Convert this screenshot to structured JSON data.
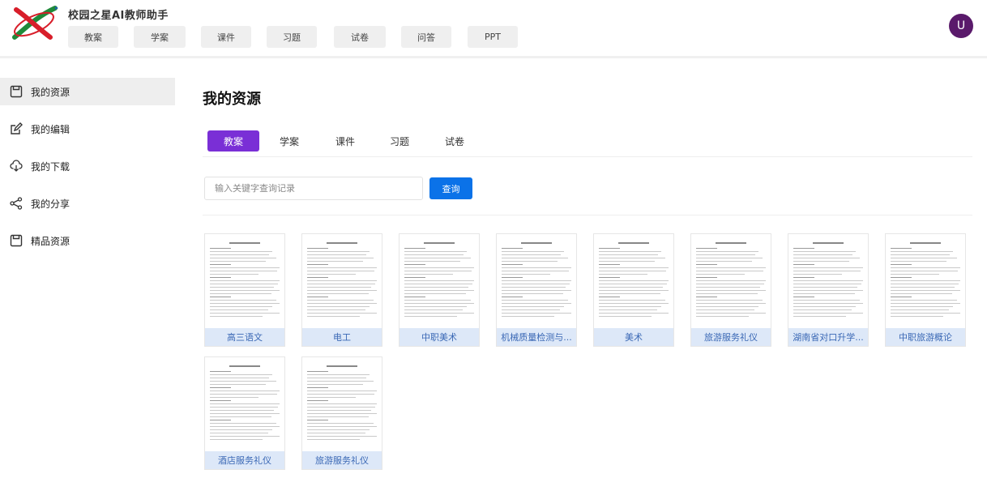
{
  "app": {
    "title": "校园之星AI教师助手"
  },
  "topnav": [
    "教案",
    "学案",
    "课件",
    "习题",
    "试卷",
    "问答",
    "PPT"
  ],
  "user": {
    "avatar_letter": "U",
    "avatar_color": "#5a1a6b"
  },
  "sidebar": {
    "items": [
      {
        "label": "我的资源",
        "icon": "save-icon",
        "active": true
      },
      {
        "label": "我的编辑",
        "icon": "edit-icon"
      },
      {
        "label": "我的下载",
        "icon": "cloud-download-icon"
      },
      {
        "label": "我的分享",
        "icon": "share-icon"
      },
      {
        "label": "精品资源",
        "icon": "save-icon"
      }
    ]
  },
  "main": {
    "title": "我的资源",
    "tabs": [
      {
        "label": "教案",
        "active": true
      },
      {
        "label": "学案"
      },
      {
        "label": "课件"
      },
      {
        "label": "习题"
      },
      {
        "label": "试卷"
      }
    ],
    "search": {
      "placeholder": "输入关键字查询记录",
      "value": "",
      "button": "查询"
    },
    "cards": [
      "高三语文",
      "电工",
      "中职美术",
      "机械质量检测与...",
      "美术",
      "旅游服务礼仪",
      "湖南省对口升学...",
      "中职旅游概论",
      "酒店服务礼仪",
      "旅游服务礼仪"
    ]
  },
  "colors": {
    "accent": "#7a2fd6",
    "button_blue": "#0b72e8",
    "card_label_bg": "#dde8f8",
    "card_label_text": "#3a68b5"
  }
}
